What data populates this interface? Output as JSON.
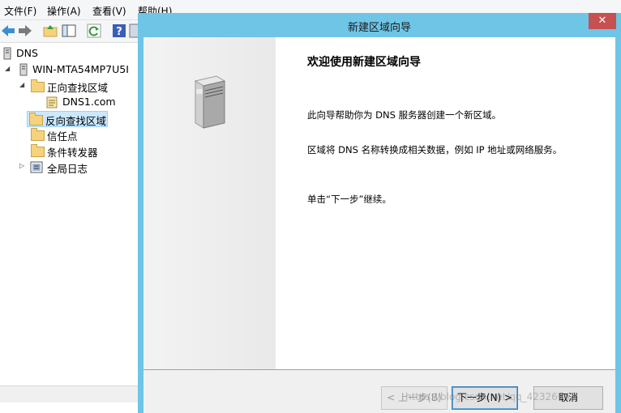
{
  "menubar": {
    "file": "文件(F)",
    "action": "操作(A)",
    "view": "查看(V)",
    "help": "帮助(H)"
  },
  "tree": {
    "root": "DNS",
    "server": "WIN-MTA54MP7U5I",
    "forward_zones": "正向查找区域",
    "zone1": "DNS1.com",
    "reverse_zones": "反向查找区域",
    "trust_points": "信任点",
    "conditional_forwarders": "条件转发器",
    "global_logs": "全局日志"
  },
  "dialog": {
    "title": "新建区域向导",
    "close": "✕",
    "heading": "欢迎使用新建区域向导",
    "para1": "此向导帮助你为 DNS 服务器创建一个新区域。",
    "para2": "区域将 DNS 名称转换成相关数据，例如 IP 地址或网络服务。",
    "para3": "单击“下一步”继续。",
    "back_button": "< 上一步(B)",
    "next_button": "下一步(N) >",
    "cancel_button": "取消"
  },
  "watermark": "https://blog.csdn.net/qq_42326043"
}
